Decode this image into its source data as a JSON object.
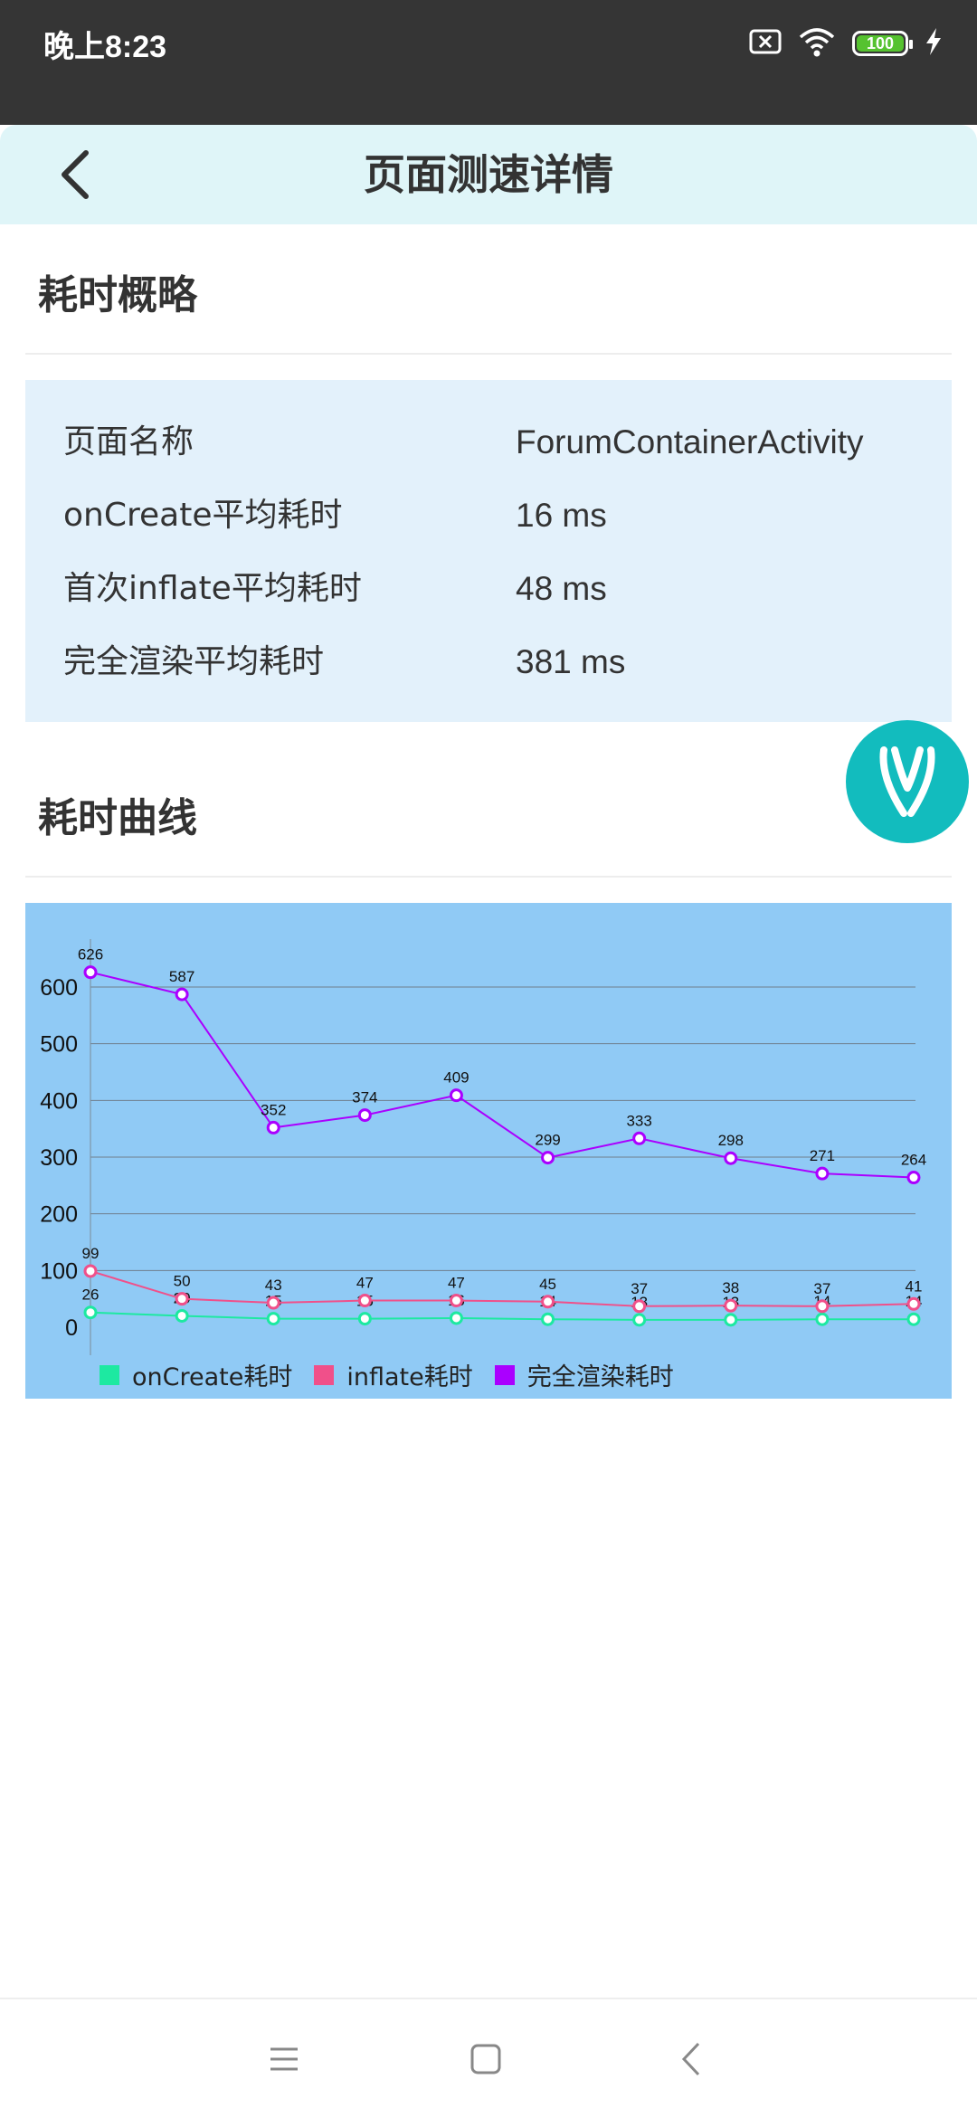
{
  "status_bar": {
    "time": "晚上8:23",
    "battery": "100"
  },
  "header": {
    "title": "页面测速详情"
  },
  "summary": {
    "title": "耗时概略",
    "rows": [
      {
        "label": "页面名称",
        "value": "ForumContainerActivity"
      },
      {
        "label": "onCreate平均耗时",
        "value": "16 ms"
      },
      {
        "label": "首次inflate平均耗时",
        "value": "48 ms"
      },
      {
        "label": "完全渲染平均耗时",
        "value": "381 ms"
      }
    ]
  },
  "curve": {
    "title": "耗时曲线"
  },
  "colors": {
    "oncreate": "#1de9a1",
    "inflate": "#f0508a",
    "render": "#aa00ff"
  },
  "chart_data": {
    "type": "line",
    "title": "",
    "xlabel": "",
    "ylabel": "",
    "ylim": [
      0,
      650
    ],
    "y_ticks": [
      "600",
      "500",
      "400",
      "300",
      "200",
      "100",
      "0"
    ],
    "grid": true,
    "legend_position": "bottom-left",
    "x": [
      1,
      2,
      3,
      4,
      5,
      6,
      7,
      8,
      9,
      10
    ],
    "series": [
      {
        "name": "onCreate耗时",
        "color": "#1de9a1",
        "values": [
          26,
          20,
          15,
          15,
          16,
          14,
          13,
          13,
          14,
          14
        ]
      },
      {
        "name": "inflate耗时",
        "color": "#f0508a",
        "values": [
          99,
          50,
          43,
          47,
          47,
          45,
          37,
          38,
          37,
          41
        ]
      },
      {
        "name": "完全渲染耗时",
        "color": "#aa00ff",
        "values": [
          626,
          587,
          352,
          374,
          409,
          299,
          333,
          298,
          271,
          264
        ]
      }
    ]
  }
}
